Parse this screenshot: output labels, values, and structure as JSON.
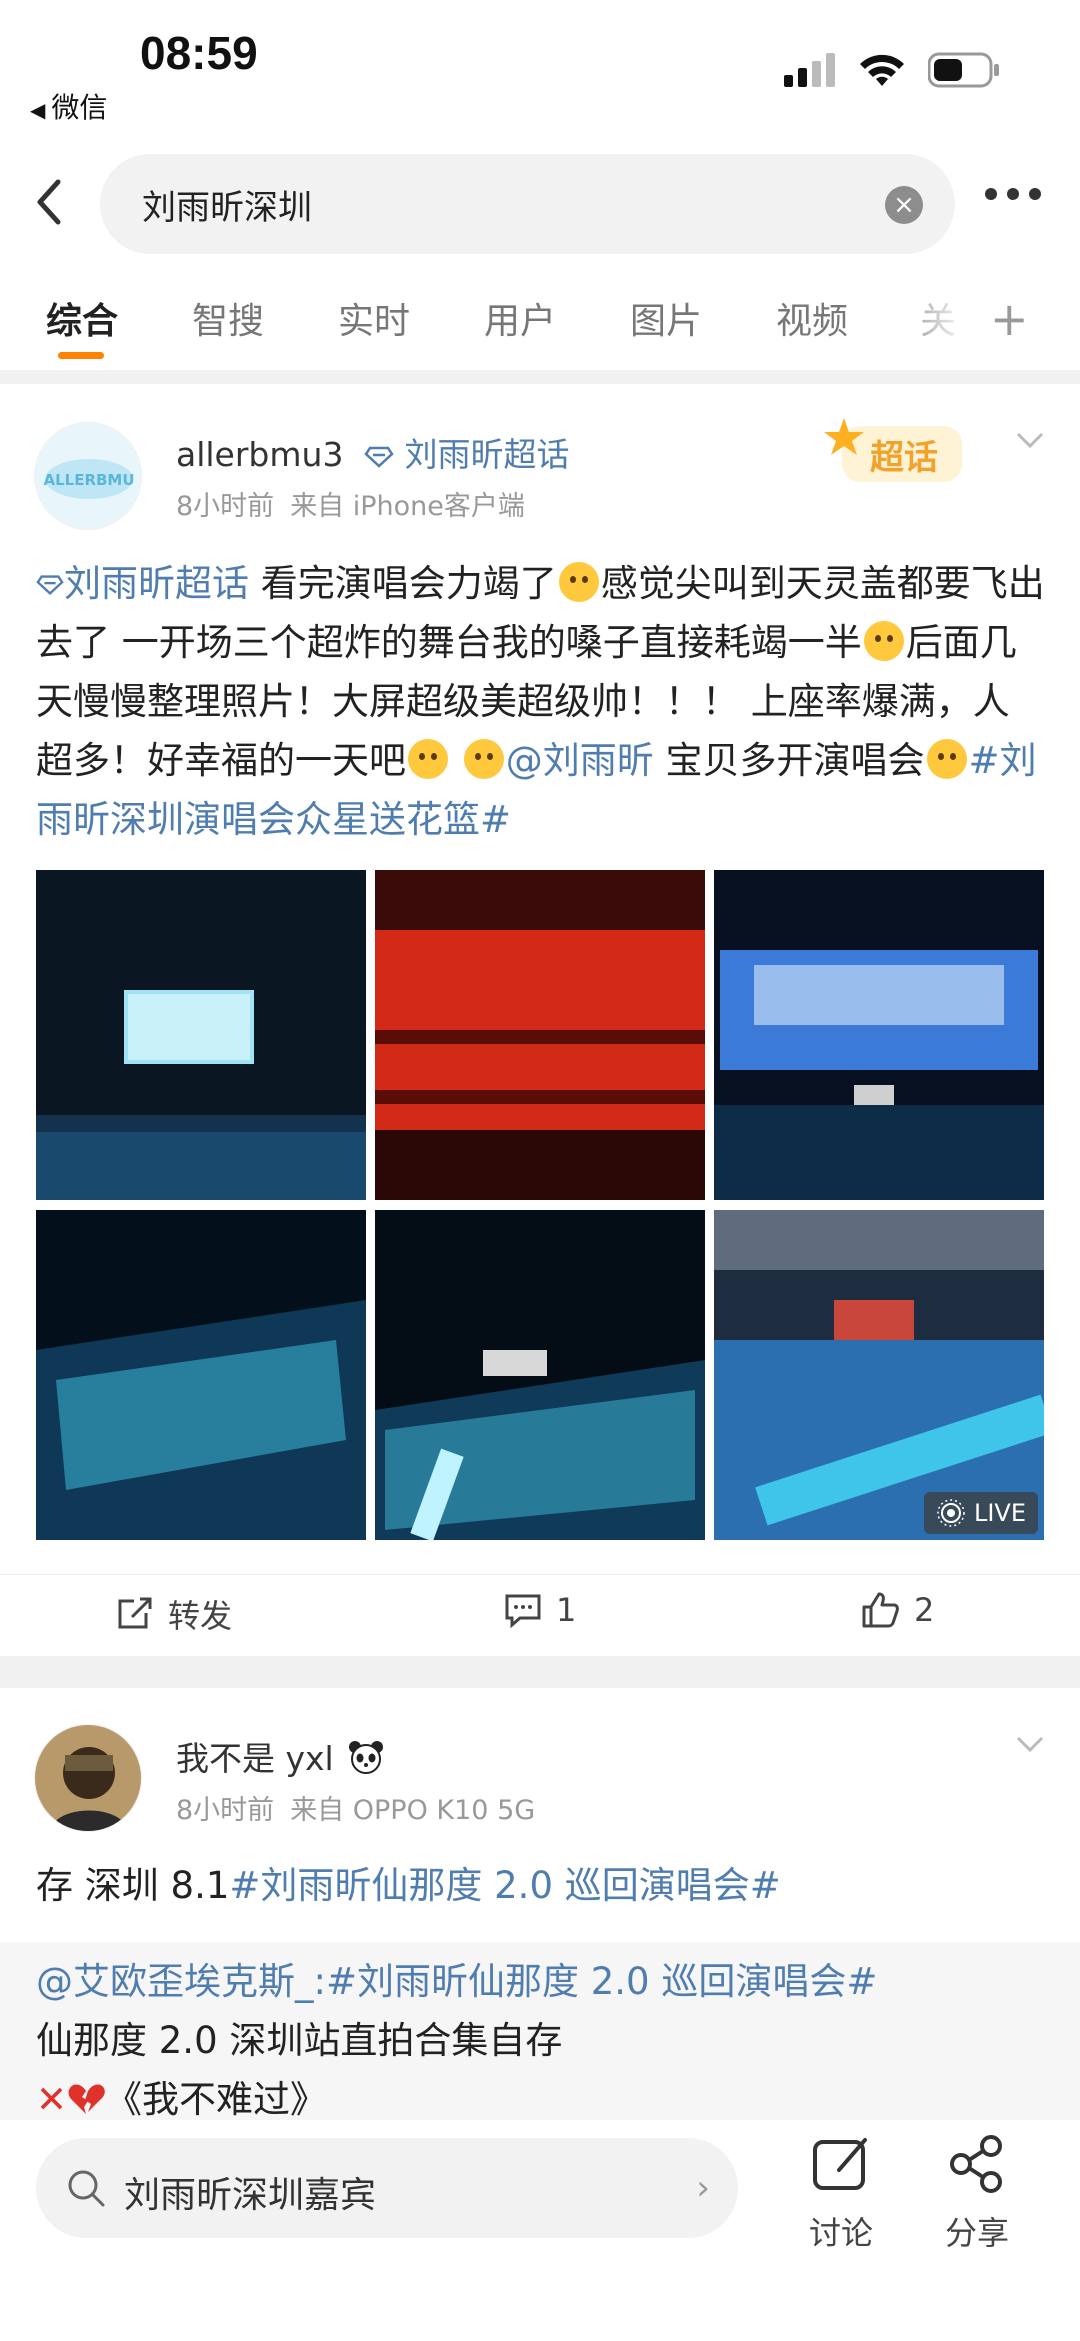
{
  "status": {
    "time": "08:59",
    "back_app": "微信"
  },
  "search": {
    "query": "刘雨昕深圳"
  },
  "tabs": [
    "综合",
    "智搜",
    "实时",
    "用户",
    "图片",
    "视频",
    "关"
  ],
  "colors": {
    "accent": "#ff8200",
    "link": "#507daf"
  },
  "post1": {
    "username": "allerbmu3",
    "supertopic": "刘雨昕超话",
    "badge": "超话",
    "time": "8小时前",
    "source": "来自 iPhone客户端",
    "text": {
      "topic": "刘雨昕超话",
      "t1": " 看完演唱会力竭了",
      "t2": "感觉尖叫到天灵盖都要飞出去了 一开场三个超炸的舞台我的嗓子直接耗竭一半",
      "t3": "后面几天慢慢整理照片！大屏超级美超级帅！！！ 上座率爆满，人超多！好幸福的一天吧",
      "mention": "@刘雨昕",
      "t4": " 宝贝多开演唱会",
      "hashtag": "#刘雨昕深圳演唱会众星送花篮#"
    },
    "live_label": "LIVE",
    "repost_label": "转发",
    "comment_count": "1",
    "like_count": "2"
  },
  "post2": {
    "username": "我不是 yxl",
    "time": "8小时前",
    "source": "来自 OPPO K10 5G",
    "text_prefix": "存 深圳 8.1",
    "hashtag": "#刘雨昕仙那度 2.0 巡回演唱会#",
    "quote": {
      "author": "@艾欧歪埃克斯_",
      "hashtag": ":#刘雨昕仙那度 2.0 巡回演唱会#",
      "line2": "仙那度 2.0 深圳站直拍合集自存",
      "line3": "《我不难过》"
    }
  },
  "bottom_bar": {
    "search_suggestion": "刘雨昕深圳嘉宾",
    "discuss": "讨论",
    "share": "分享"
  }
}
